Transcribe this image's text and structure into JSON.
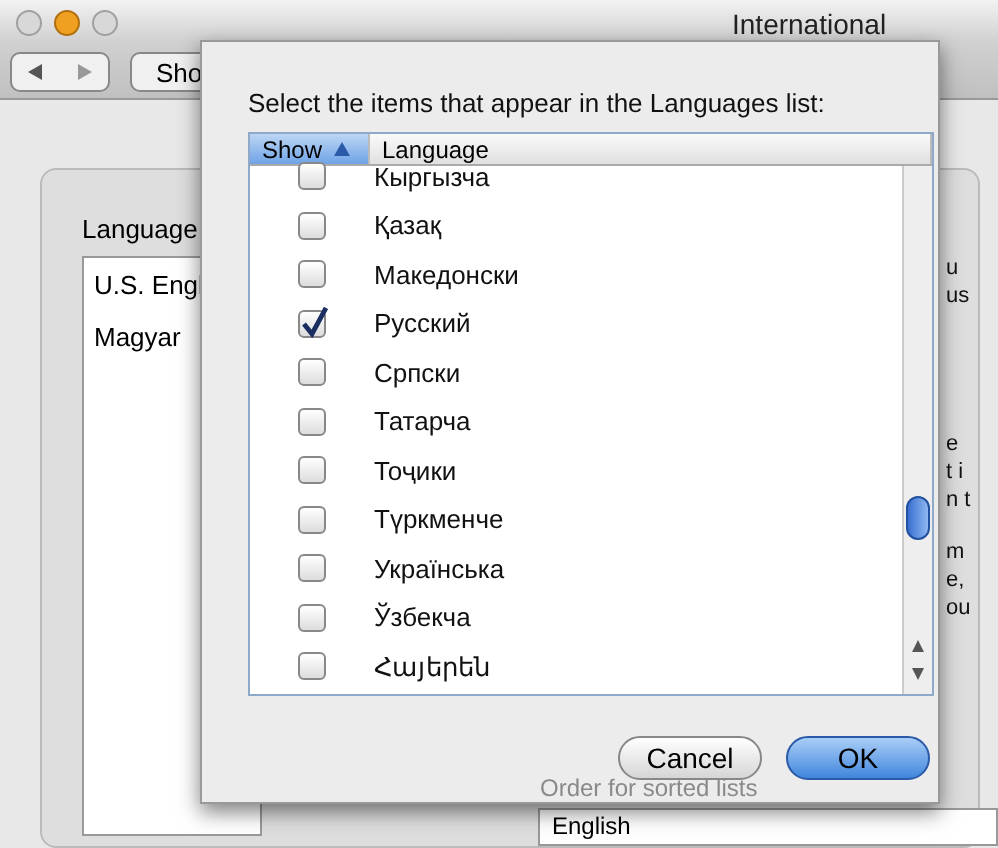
{
  "window": {
    "title": "International"
  },
  "toolbar": {
    "show_all": "Sho"
  },
  "background": {
    "list_label": "Language",
    "list_items": [
      "U.S. Engl",
      "Magyar"
    ],
    "right_fragments": [
      "u",
      "us",
      "e",
      "t i",
      "n t",
      "m",
      "e,",
      "ou"
    ],
    "sorted_label": "Order for sorted lists",
    "sorted_value": "English"
  },
  "sheet": {
    "prompt": "Select the items that appear in the Languages list:",
    "columns": [
      {
        "label": "Show",
        "sorted": true
      },
      {
        "label": "Language",
        "sorted": false
      }
    ],
    "rows": [
      {
        "language": "Кыргызча",
        "checked": false
      },
      {
        "language": "Қазақ",
        "checked": false
      },
      {
        "language": "Македонски",
        "checked": false
      },
      {
        "language": "Русский",
        "checked": true
      },
      {
        "language": "Српски",
        "checked": false
      },
      {
        "language": "Татарча",
        "checked": false
      },
      {
        "language": "Тоҷики",
        "checked": false
      },
      {
        "language": "Түркменче",
        "checked": false
      },
      {
        "language": "Українська",
        "checked": false
      },
      {
        "language": "Ўзбекча",
        "checked": false
      },
      {
        "language": "Հայերեն",
        "checked": false
      }
    ],
    "buttons": [
      {
        "label": "Cancel",
        "kind": "secondary"
      },
      {
        "label": "OK",
        "kind": "default"
      }
    ]
  }
}
